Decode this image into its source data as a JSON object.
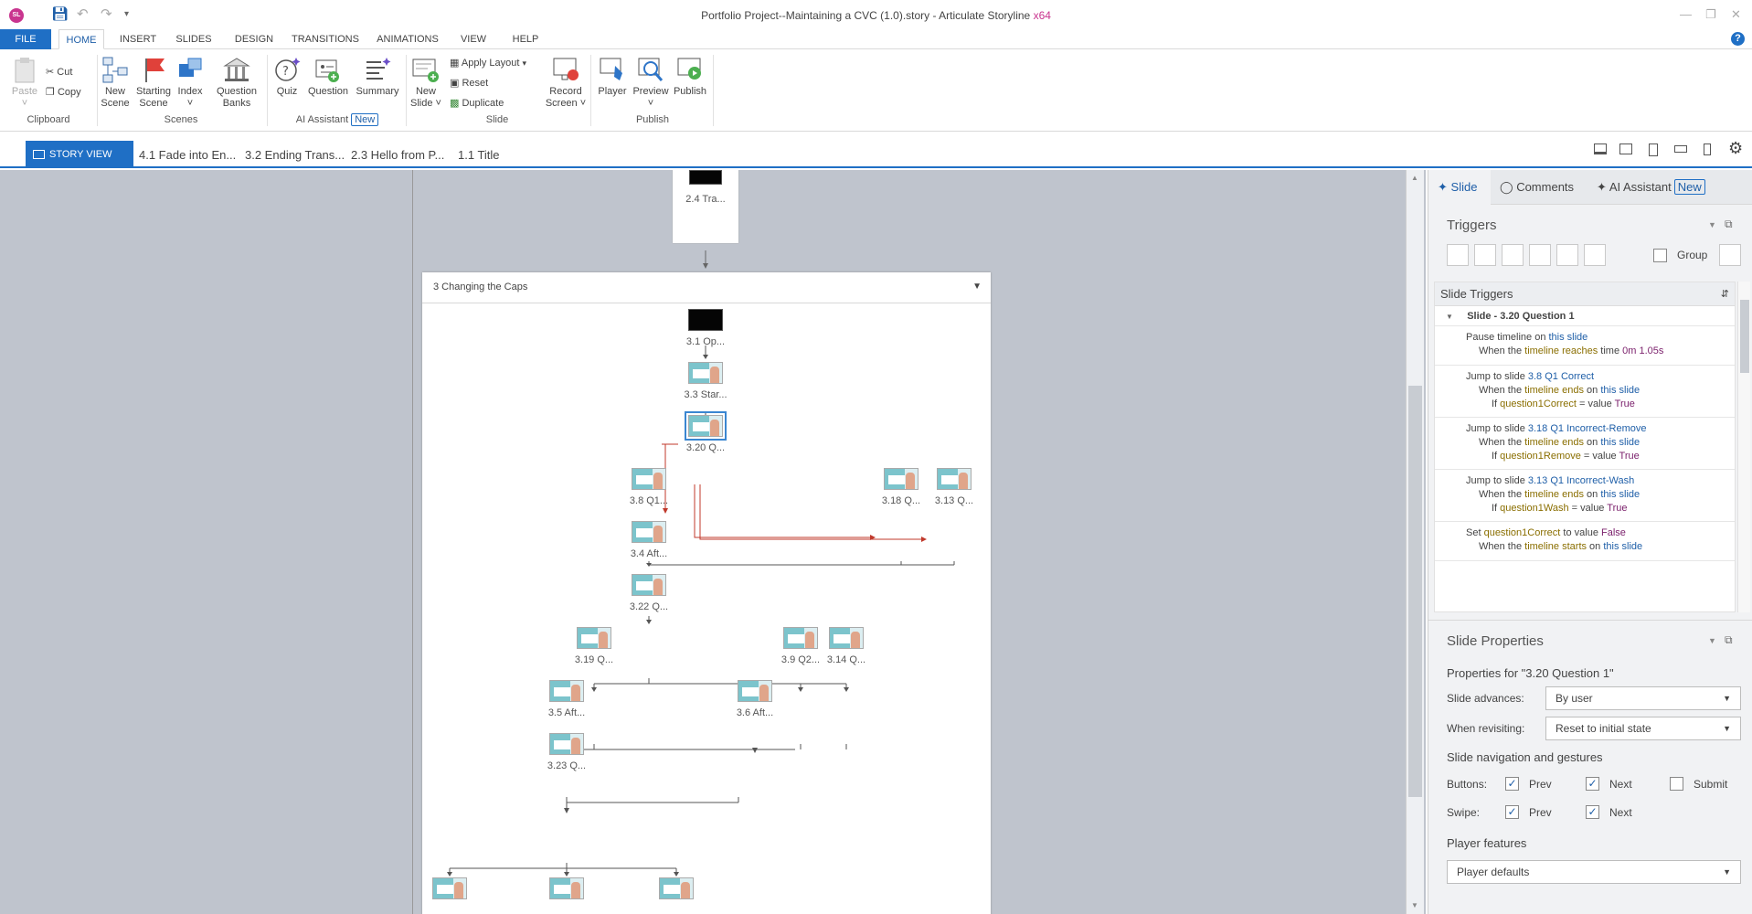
{
  "window": {
    "logo": "SL",
    "title": "Portfolio Project--Maintaining a CVC (1.0).story - Articulate Storyline",
    "arch": "x64"
  },
  "quick_access_icons": [
    "save-icon",
    "undo-icon",
    "redo-icon",
    "dropdown-icon"
  ],
  "tabs": [
    "FILE",
    "HOME",
    "INSERT",
    "SLIDES",
    "DESIGN",
    "TRANSITIONS",
    "ANIMATIONS",
    "VIEW",
    "HELP"
  ],
  "help_label": "?",
  "ribbon": {
    "clipboard": {
      "paste": "Paste",
      "cut": "Cut",
      "copy": "Copy",
      "group": "Clipboard"
    },
    "scenes": {
      "new_scene": "New Scene",
      "starting_scene": "Starting Scene",
      "index": "Index",
      "question_banks": "Question Banks",
      "group": "Scenes"
    },
    "ai": {
      "quiz": "Quiz",
      "question": "Question",
      "summary": "Summary",
      "group": "AI Assistant",
      "badge": "New"
    },
    "slide": {
      "new_slide": "New Slide",
      "apply_layout": "Apply Layout",
      "reset": "Reset",
      "duplicate": "Duplicate",
      "group": "Slide"
    },
    "record": {
      "record_screen": "Record Screen"
    },
    "publish": {
      "player": "Player",
      "preview": "Preview",
      "publish": "Publish",
      "group": "Publish"
    }
  },
  "viewbar": {
    "story_view": "STORY VIEW",
    "open_slides": [
      "4.1 Fade into En...",
      "3.2 Ending Trans...",
      "2.3 Hello from P...",
      "1.1 Title"
    ]
  },
  "canvas": {
    "top_card_label": "2.4 Tra...",
    "scene_title": "3 Changing the Caps",
    "nodes": [
      {
        "label": "3.1 Op...",
        "style": "black"
      },
      {
        "label": "3.3 Star...",
        "style": "screen"
      },
      {
        "label": "3.20 Q...",
        "style": "screen",
        "selected": true
      },
      {
        "label": "3.8 Q1...",
        "style": "screen"
      },
      {
        "label": "3.18 Q...",
        "style": "screen"
      },
      {
        "label": "3.13 Q...",
        "style": "screen"
      },
      {
        "label": "3.4 Aft...",
        "style": "screen"
      },
      {
        "label": "3.22 Q...",
        "style": "screen"
      },
      {
        "label": "3.19 Q...",
        "style": "screen"
      },
      {
        "label": "3.9 Q2...",
        "style": "screen"
      },
      {
        "label": "3.14 Q...",
        "style": "screen"
      },
      {
        "label": "3.5 Aft...",
        "style": "screen"
      },
      {
        "label": "3.6 Aft...",
        "style": "screen"
      },
      {
        "label": "3.23 Q...",
        "style": "screen"
      }
    ]
  },
  "panel": {
    "tabs": {
      "slide": "Slide",
      "comments": "Comments",
      "ai_assistant": "AI Assistant",
      "ai_badge": "New"
    },
    "triggers_title": "Triggers",
    "group_label": "Group",
    "slide_triggers_header": "Slide Triggers",
    "trigger_group": "Slide - 3.20 Question 1",
    "triggers": [
      {
        "l1": [
          "Pause timeline on ",
          "this slide"
        ],
        "l2": [
          "When the ",
          "timeline reaches",
          " time ",
          "0m 1.05s"
        ]
      },
      {
        "l1": [
          "Jump to slide ",
          "3.8 Q1 Correct"
        ],
        "l2": [
          "When the ",
          "timeline ends",
          " on ",
          "this slide"
        ],
        "l3": [
          "If ",
          "question1Correct",
          " = value ",
          "True"
        ]
      },
      {
        "l1": [
          "Jump to slide ",
          "3.18 Q1 Incorrect-Remove"
        ],
        "l2": [
          "When the ",
          "timeline ends",
          " on ",
          "this slide"
        ],
        "l3": [
          "If ",
          "question1Remove",
          " = value ",
          "True"
        ]
      },
      {
        "l1": [
          "Jump to slide ",
          "3.13 Q1 Incorrect-Wash"
        ],
        "l2": [
          "When the ",
          "timeline ends",
          " on ",
          "this slide"
        ],
        "l3": [
          "If ",
          "question1Wash",
          " = value ",
          "True"
        ]
      },
      {
        "l1": [
          "Set ",
          "question1Correct",
          " to value ",
          "False"
        ],
        "l2": [
          "When the ",
          "timeline starts",
          " on ",
          "this slide"
        ]
      }
    ],
    "props_title": "Slide Properties",
    "props_for": "Properties for \"3.20 Question 1\"",
    "slide_advances_label": "Slide advances:",
    "slide_advances": "By user",
    "when_revisiting_label": "When revisiting:",
    "when_revisiting": "Reset to initial state",
    "nav_title": "Slide navigation and gestures",
    "buttons_label": "Buttons:",
    "swipe_label": "Swipe:",
    "prev": "Prev",
    "next": "Next",
    "submit": "Submit",
    "player_features_title": "Player features",
    "player_features": "Player defaults"
  },
  "colors": {
    "accent": "#1f6fc5",
    "brand": "#c9358f",
    "branch_line": "#c0392b"
  }
}
